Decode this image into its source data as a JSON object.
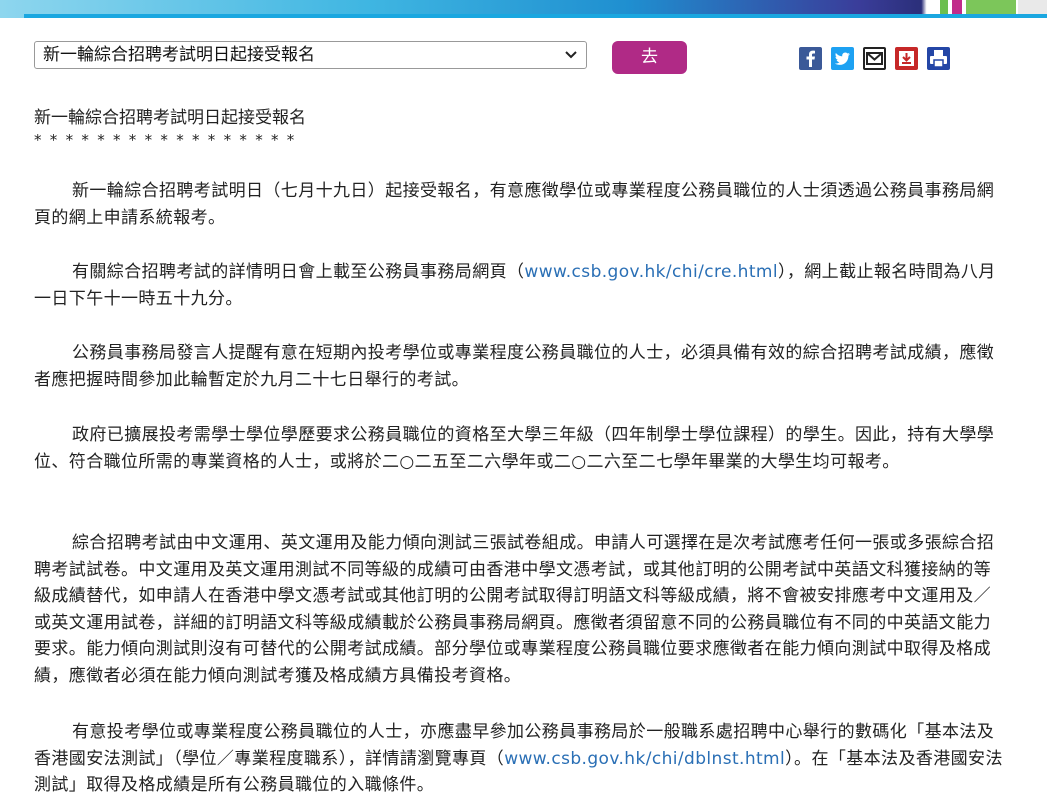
{
  "colors": {
    "accent": "#b02a86",
    "link": "#2a6fb5",
    "topbar": "#1aa7e0"
  },
  "nav": {
    "selected_option": "新一輪綜合招聘考試明日起接受報名",
    "go_label": "去"
  },
  "share_icons": [
    "facebook-icon",
    "twitter-icon",
    "email-icon",
    "download-icon",
    "print-icon"
  ],
  "article": {
    "title": "新一輪綜合招聘考試明日起接受報名",
    "stars": "*****************",
    "p1": "新一輪綜合招聘考試明日（七月十九日）起接受報名，有意應徵學位或專業程度公務員職位的人士須透過公務員事務局網頁的網上申請系統報考。",
    "p2_a": "有關綜合招聘考試的詳情明日會上載至公務員事務局網頁（",
    "p2_link": "www.csb.gov.hk/chi/cre.html",
    "p2_b": "），網上截止報名時間為八月一日下午十一時五十九分。",
    "p3": "公務員事務局發言人提醒有意在短期內投考學位或專業程度公務員職位的人士，必須具備有效的綜合招聘考試成績，應徵者應把握時間參加此輪暫定於九月二十七日舉行的考試。",
    "p4": "政府已擴展投考需學士學位學歷要求公務員職位的資格至大學三年級（四年制學士學位課程）的學生。因此，持有大學學位、符合職位所需的專業資格的人士，或將於二○二五至二六學年或二○二六至二七學年畢業的大學生均可報考。",
    "p5": "綜合招聘考試由中文運用、英文運用及能力傾向測試三張試卷組成。申請人可選擇在是次考試應考任何一張或多張綜合招聘考試試卷。中文運用及英文運用測試不同等級的成績可由香港中學文憑考試，或其他訂明的公開考試中英語文科獲接納的等級成績替代，如申請人在香港中學文憑考試或其他訂明的公開考試取得訂明語文科等級成績，將不會被安排應考中文運用及／或英文運用試卷，詳細的訂明語文科等級成績載於公務員事務局網頁。應徵者須留意不同的公務員職位有不同的中英語文能力要求。能力傾向測試則沒有可替代的公開考試成績。部分學位或專業程度公務員職位要求應徵者在能力傾向測試中取得及格成績，應徵者必須在能力傾向測試考獲及格成績方具備投考資格。",
    "p6_a": "有意投考學位或專業程度公務員職位的人士，亦應盡早參加公務員事務局於一般職系處招聘中心舉行的數碼化「基本法及香港國安法測試」（學位／專業程度職系），詳情請瀏覽專頁（",
    "p6_link": "www.csb.gov.hk/chi/dblnst.html",
    "p6_b": "）。在「基本法及香港國安法測試」取得及格成績是所有公務員職位的入職條件。"
  }
}
